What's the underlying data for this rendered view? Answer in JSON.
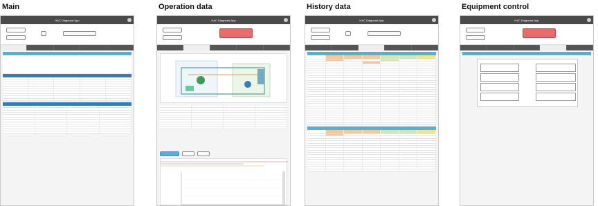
{
  "panels": [
    {
      "title": "Main"
    },
    {
      "title": "Operation data"
    },
    {
      "title": "History data"
    },
    {
      "title": "Equipment control"
    }
  ],
  "app": {
    "title": "HAC Diagnosis App"
  },
  "colors": {
    "section": "#4fb3d9",
    "red_button": "#e86a6a",
    "titlebar": "#4a4a4a"
  }
}
